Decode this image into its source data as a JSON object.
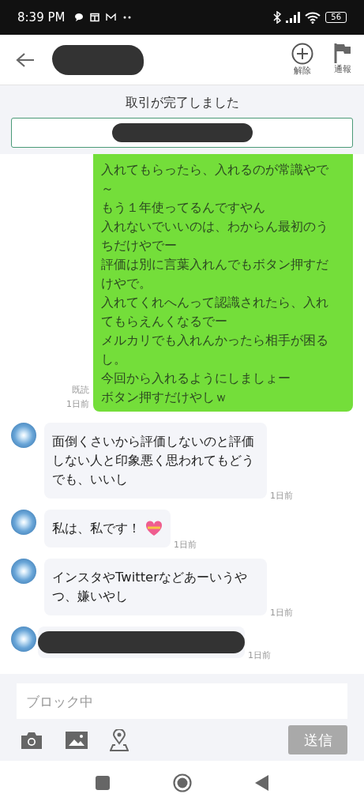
{
  "status_bar": {
    "time": "8:39 PM",
    "battery": "56"
  },
  "header": {
    "actions": [
      {
        "kind": "unblock",
        "label": "解除"
      },
      {
        "kind": "report",
        "label": "通報"
      }
    ]
  },
  "notice": {
    "title": "取引が完了しました"
  },
  "messages": [
    {
      "kind": "outgoing",
      "lines": [
        "入れてもらったら、入れるのが常識やで～",
        "もう１年使ってるんですやん",
        "入れないでいいのは、わからん最初のうちだけやでー",
        "評価は別に言葉入れんでもボタン押すだけやで。",
        "入れてくれへんって認識されたら、入れてもらえんくなるでー",
        "メルカリでも入れんかったら相手が困るし。",
        "今回から入れるようにしましょー",
        "ボタン押すだけやしｗ"
      ],
      "read": "既読",
      "time": "1日前"
    },
    {
      "kind": "incoming",
      "text": "面倒くさいから評価しないのと評価しない人と印象悪く思われてもどうでも、いいし",
      "heart": false,
      "time": "1日前"
    },
    {
      "kind": "incoming",
      "text": "私は、私です！",
      "heart": true,
      "time": "1日前"
    },
    {
      "kind": "incoming",
      "text": "インスタやTwitterなどあーいうやつ、嫌いやし",
      "heart": false,
      "time": "1日前"
    },
    {
      "kind": "redacted",
      "time": "1日前"
    }
  ],
  "composer": {
    "placeholder": "ブロック中",
    "send": "送信",
    "send_disabled": true
  }
}
